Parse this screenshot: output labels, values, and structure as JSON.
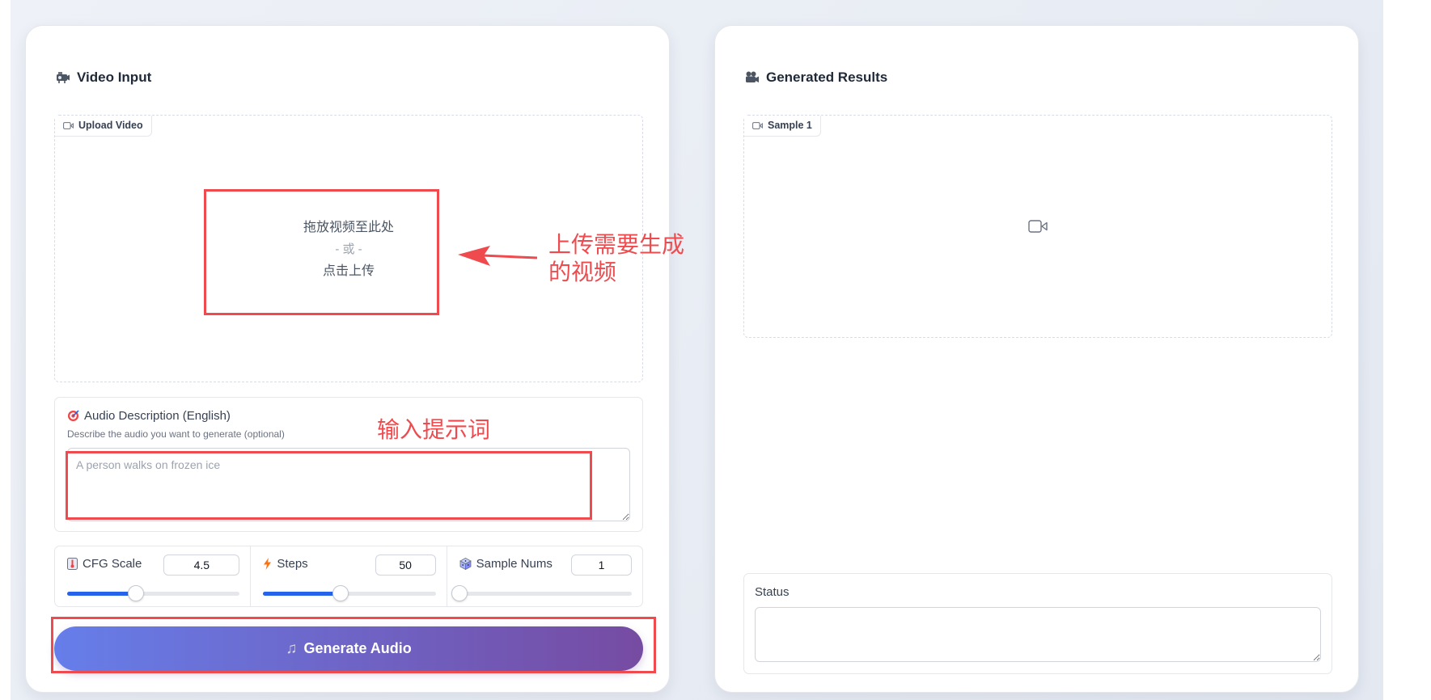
{
  "video_input": {
    "title": "Video Input",
    "title_icon": "projector-icon",
    "upload": {
      "tag": "Upload Video",
      "drop_text": "拖放视频至此处",
      "or_text": "- 或 -",
      "click_text": "点击上传"
    },
    "description": {
      "label": "Audio Description (English)",
      "label_icon": "target-icon",
      "info": "Describe the audio you want to generate (optional)",
      "placeholder": "A person walks on frozen ice",
      "value": ""
    },
    "params": [
      {
        "label": "CFG Scale",
        "icon": "thermometer-icon",
        "value": "4.5",
        "fill_percent": 40
      },
      {
        "label": "Steps",
        "icon": "lightning-icon",
        "value": "50",
        "fill_percent": 45
      },
      {
        "label": "Sample Nums",
        "icon": "dice-icon",
        "value": "1",
        "fill_percent": 0
      }
    ],
    "generate_button": {
      "label": "Generate Audio",
      "icon": "music-note-icon"
    }
  },
  "generated_results": {
    "title": "Generated Results",
    "title_icon": "movie-camera-icon",
    "sample_tag": "Sample 1",
    "status_label": "Status",
    "status_value": ""
  },
  "annotations": {
    "upload_note": "上传需要生成\n的视频",
    "prompt_note": "输入提示词",
    "color": "#ef4b4f"
  },
  "colors": {
    "accent_start": "#667eea",
    "accent_end": "#764ba2",
    "slider_fill": "#2563eb"
  }
}
